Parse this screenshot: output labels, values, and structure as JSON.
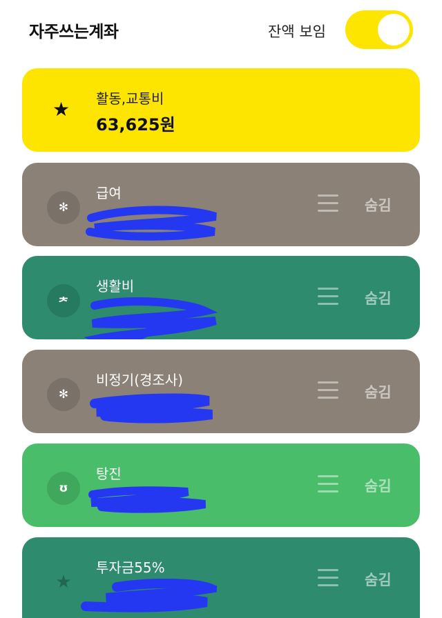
{
  "header": {
    "title": "자주쓰는계좌",
    "balance_label": "잔액 보임",
    "balance_toggle_on": true
  },
  "colors": {
    "brand_yellow": "#fee500",
    "gray": "#8b8177",
    "teal": "#2e8b6d",
    "green": "#4abd6a",
    "scribble": "#2438f2"
  },
  "accounts": [
    {
      "name": "활동,교통비",
      "amount": "63,625원",
      "icon": "star-icon",
      "color": "#fee500"
    },
    {
      "name": "급여",
      "icon": "kookmin-bank-icon",
      "icon_glyph": "✻",
      "color": "#8b8177",
      "hide_label": "숨김"
    },
    {
      "name": "생활비",
      "icon": "hana-bank-icon",
      "icon_glyph": "ᅔ",
      "color": "#2e8b6d",
      "hide_label": "숨김"
    },
    {
      "name": "비정기(경조사)",
      "icon": "kookmin-bank-icon",
      "icon_glyph": "✻",
      "color": "#8b8177",
      "hide_label": "숨김"
    },
    {
      "name": "탕진",
      "icon": "nonghyup-bank-icon",
      "icon_glyph": "ʊ",
      "color": "#4abd6a",
      "hide_label": "숨김"
    },
    {
      "name": "투자금55%",
      "icon": "star-icon",
      "icon_glyph": "★",
      "color": "#2e8b6d",
      "hide_label": "숨김"
    }
  ]
}
